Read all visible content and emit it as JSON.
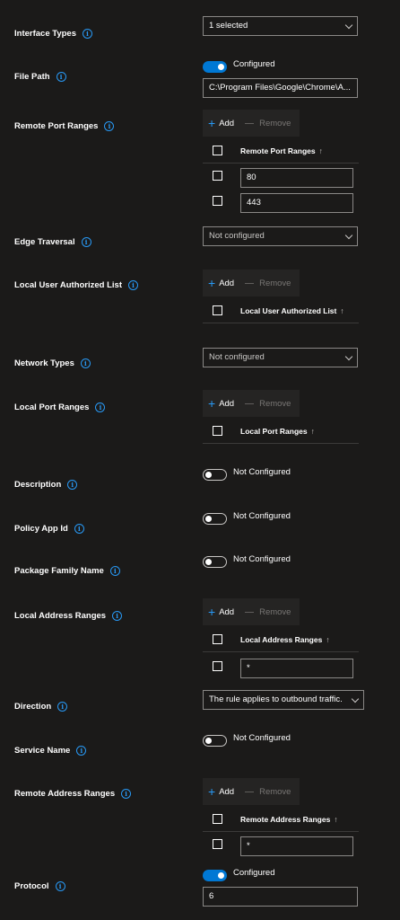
{
  "fields": {
    "interface_types": {
      "label": "Interface Types",
      "value": "1 selected"
    },
    "file_path": {
      "label": "File Path",
      "toggle": "Configured",
      "value": "C:\\Program Files\\Google\\Chrome\\A..."
    },
    "remote_port_ranges": {
      "label": "Remote Port Ranges",
      "add": "Add",
      "remove": "Remove",
      "column": "Remote Port Ranges",
      "sort": "↑",
      "rows": [
        "80",
        "443"
      ]
    },
    "edge_traversal": {
      "label": "Edge Traversal",
      "value": "Not configured"
    },
    "local_user_authorized_list": {
      "label": "Local User Authorized List",
      "add": "Add",
      "remove": "Remove",
      "column": "Local User Authorized List",
      "sort": "↑"
    },
    "network_types": {
      "label": "Network Types",
      "value": "Not configured"
    },
    "local_port_ranges": {
      "label": "Local Port Ranges",
      "add": "Add",
      "remove": "Remove",
      "column": "Local Port Ranges",
      "sort": "↑"
    },
    "description": {
      "label": "Description",
      "toggle": "Not Configured"
    },
    "policy_app_id": {
      "label": "Policy App Id",
      "toggle": "Not Configured"
    },
    "package_family_name": {
      "label": "Package Family Name",
      "toggle": "Not Configured"
    },
    "local_address_ranges": {
      "label": "Local Address Ranges",
      "add": "Add",
      "remove": "Remove",
      "column": "Local Address Ranges",
      "sort": "↑",
      "rows": [
        "*"
      ]
    },
    "direction": {
      "label": "Direction",
      "value": "The rule applies to outbound traffic."
    },
    "service_name": {
      "label": "Service Name",
      "toggle": "Not Configured"
    },
    "remote_address_ranges": {
      "label": "Remote Address Ranges",
      "add": "Add",
      "remove": "Remove",
      "column": "Remote Address Ranges",
      "sort": "↑",
      "rows": [
        "*"
      ]
    },
    "protocol": {
      "label": "Protocol",
      "toggle": "Configured",
      "value": "6"
    }
  },
  "info_icon": "info-icon",
  "colors": {
    "background": "#1b1a19",
    "accent": "#0078d4",
    "icon": "#2899f5",
    "border": "#8a8886"
  }
}
